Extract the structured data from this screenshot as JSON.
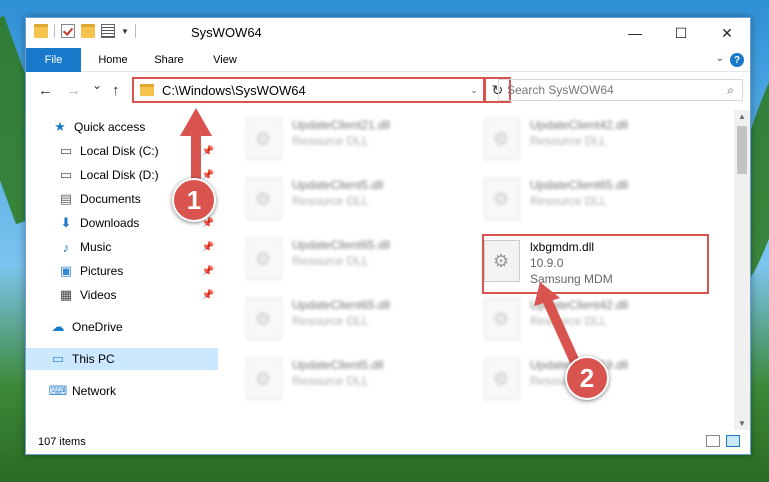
{
  "window": {
    "title": "SysWOW64",
    "controls": {
      "minimize": "—",
      "maximize": "☐",
      "close": "✕"
    }
  },
  "ribbon": {
    "tabs": [
      {
        "label": "File"
      },
      {
        "label": "Home"
      },
      {
        "label": "Share"
      },
      {
        "label": "View"
      }
    ],
    "help": "?"
  },
  "nav": {
    "back": "←",
    "forward": "→",
    "recent": "⌄",
    "up": "↑",
    "address": "C:\\Windows\\SysWOW64",
    "refresh": "↻",
    "search_placeholder": "Search SysWOW64"
  },
  "sidebar": {
    "items": [
      {
        "label": "Quick access",
        "icon": "star-icon"
      },
      {
        "label": "Local Disk (C:)",
        "icon": "drive-icon"
      },
      {
        "label": "Local Disk (D:)",
        "icon": "drive-icon"
      },
      {
        "label": "Documents",
        "icon": "documents-icon"
      },
      {
        "label": "Downloads",
        "icon": "download-icon"
      },
      {
        "label": "Music",
        "icon": "music-icon"
      },
      {
        "label": "Pictures",
        "icon": "pictures-icon"
      },
      {
        "label": "Videos",
        "icon": "videos-icon"
      },
      {
        "label": "OneDrive",
        "icon": "cloud-icon"
      },
      {
        "label": "This PC",
        "icon": "computer-icon"
      },
      {
        "label": "Network",
        "icon": "network-icon"
      }
    ]
  },
  "files": [
    {
      "name": "UpdateClient21.dll",
      "sub": "Resource DLL"
    },
    {
      "name": "UpdateClient42.dll",
      "sub": "Resource DLL"
    },
    {
      "name": "UpdateClient5.dll",
      "sub": "Resource DLL"
    },
    {
      "name": "UpdateClient65.dll",
      "sub": "Resource DLL"
    },
    {
      "name": "UpdateClient65.dll",
      "sub": "Resource DLL"
    },
    {
      "name": "lxbgmdm.dll",
      "sub": "10.9.0",
      "sub2": "Samsung MDM"
    },
    {
      "name": "UpdateClient65.dll",
      "sub": "Resource DLL"
    },
    {
      "name": "UpdateClient42.dll",
      "sub": "Resource DLL"
    },
    {
      "name": "UpdateClient5.dll",
      "sub": "Resource DLL"
    },
    {
      "name": "UpdateClient19.dll",
      "sub": "Resource DLL"
    }
  ],
  "status": {
    "count": "107 items"
  },
  "annotations": {
    "step1": "1",
    "step2": "2"
  },
  "colors": {
    "accent": "#1979ca",
    "highlight": "#d9534f"
  }
}
